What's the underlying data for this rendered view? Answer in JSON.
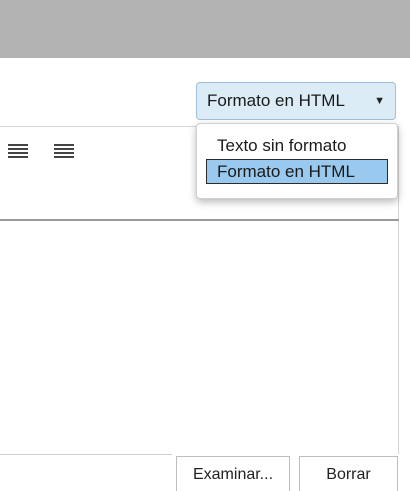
{
  "format_select": {
    "selected_label": "Formato en HTML",
    "caret_icon": "caret-down-icon"
  },
  "format_dropdown": {
    "options": [
      {
        "label": "Texto sin formato",
        "selected": false
      },
      {
        "label": "Formato en HTML",
        "selected": true
      }
    ],
    "highlight_color": "#99c9ee"
  },
  "toolbar": {
    "icons": [
      "align-justify-icon",
      "align-full-icon"
    ]
  },
  "buttons": {
    "browse_label": "Examinar...",
    "clear_label": "Borrar"
  },
  "colors": {
    "topbar": "#b3b3b3",
    "select_bg": "#dcecf7"
  }
}
